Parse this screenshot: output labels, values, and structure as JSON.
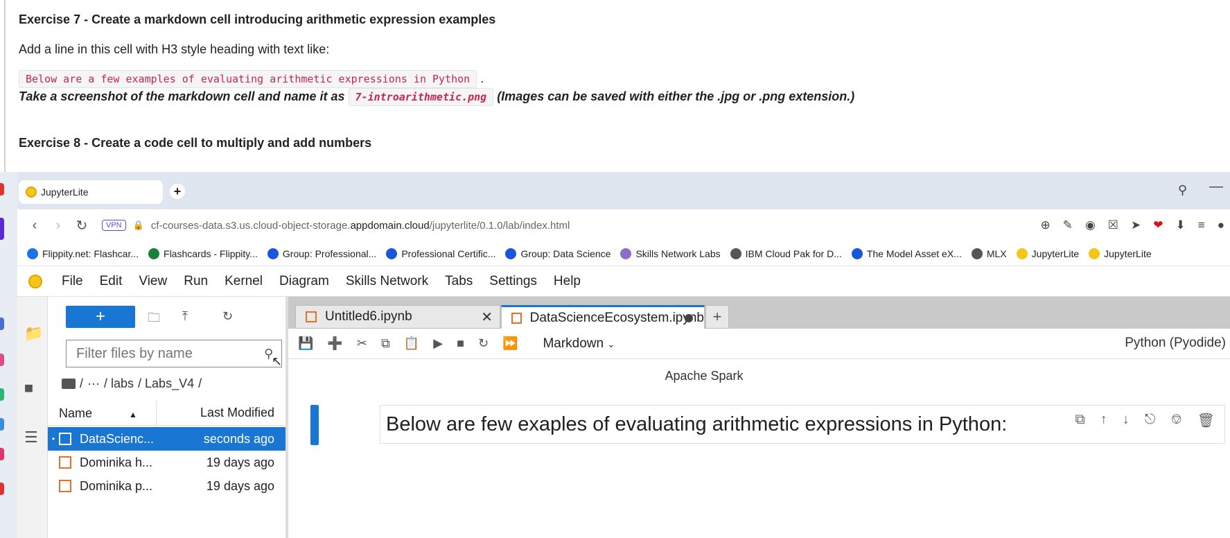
{
  "instructions": {
    "ex7_title": "Exercise 7 - Create a markdown cell introducing arithmetic expression examples",
    "ex7_line": "Add a line in this cell with H3 style heading with text like:",
    "ex7_code": "Below are a few examples of evaluating arithmetic expressions in Python",
    "ex7_period": ".",
    "screenshot_prefix": "Take a screenshot of the markdown cell and name it as",
    "screenshot_file": "7-introarithmetic.png",
    "screenshot_suffix": "(Images can be saved with either the .jpg or .png extension.)",
    "ex8_title": "Exercise 8 - Create a code cell to multiply and add numbers"
  },
  "browser": {
    "tab_title": "JupyterLite",
    "vpn_label": "VPN",
    "url_prefix": "cf-courses-data.s3.us.cloud-object-storage.",
    "url_domain": "appdomain.cloud",
    "url_path": "/jupyterlite/0.1.0/lab/index.html",
    "bookmarks": [
      {
        "label": "Flippity.net: Flashcar...",
        "icon": "flippity-icon",
        "color": "#1a73e8"
      },
      {
        "label": "Flashcards - Flippity...",
        "icon": "sheets-icon",
        "color": "#188038"
      },
      {
        "label": "Group: Professional...",
        "icon": "coursera-icon",
        "color": "#1a56db"
      },
      {
        "label": "Professional Certific...",
        "icon": "coursera-icon",
        "color": "#1a56db"
      },
      {
        "label": "Group: Data Science",
        "icon": "coursera-icon",
        "color": "#1a56db"
      },
      {
        "label": "Skills Network Labs",
        "icon": "skills-network-icon",
        "color": "#8c6cc6"
      },
      {
        "label": "IBM Cloud Pak for D...",
        "icon": "ibm-cloud-icon",
        "color": "#555555"
      },
      {
        "label": "The Model Asset eX...",
        "icon": "coursera-icon",
        "color": "#1a56db"
      },
      {
        "label": "MLX",
        "icon": "file-icon",
        "color": "#555555"
      },
      {
        "label": "JupyterLite",
        "icon": "jupyterlite-icon",
        "color": "#f5c518"
      },
      {
        "label": "JupyterLite",
        "icon": "jupyterlite-icon",
        "color": "#f5c518"
      }
    ]
  },
  "menubar": {
    "items": [
      "File",
      "Edit",
      "View",
      "Run",
      "Kernel",
      "Diagram",
      "Skills Network",
      "Tabs",
      "Settings",
      "Help"
    ]
  },
  "filebrowser": {
    "new_label": "+",
    "filter_placeholder": "Filter files by name",
    "breadcrumb": [
      "/",
      "···",
      "/ labs",
      "/ Labs_V4",
      "/"
    ],
    "col_name": "Name",
    "col_modified": "Last Modified",
    "files": [
      {
        "name": "DataScienc...",
        "modified": "seconds ago",
        "selected": true,
        "running": "•"
      },
      {
        "name": "Dominika h...",
        "modified": "19 days ago",
        "selected": false,
        "running": ""
      },
      {
        "name": "Dominika p...",
        "modified": "19 days ago",
        "selected": false,
        "running": ""
      }
    ]
  },
  "editor": {
    "tabs": [
      {
        "label": "Untitled6.ipynb",
        "active": false
      },
      {
        "label": "DataScienceEcosystem.ipynb",
        "active": true
      }
    ],
    "cell_type": "Markdown",
    "kernel": "Python (Pyodide)",
    "partial_text": "Apache Spark",
    "md_heading": "Below are few exaples of evaluating arithmetic expressions in Python:"
  },
  "colors": {
    "accent": "#1976d2",
    "code_pink": "#c7254e",
    "notebook_orange": "#e46e2e"
  }
}
